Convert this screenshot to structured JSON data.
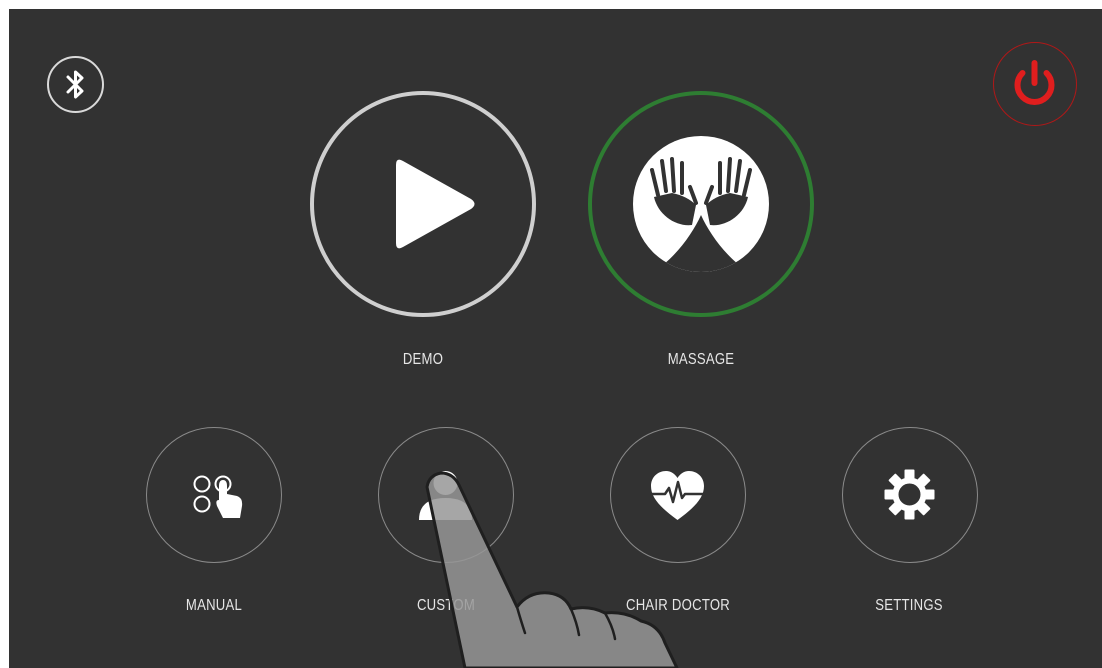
{
  "colors": {
    "background": "#323232",
    "demo_ring": "#cfcfcf",
    "massage_ring": "#2e7d32",
    "power_accent": "#e01e1e",
    "small_ring": "#8a8a8a",
    "label": "#e6e6e6"
  },
  "top_bar": {
    "bluetooth_icon": "bluetooth-icon",
    "power_icon": "power-icon"
  },
  "main_modes": [
    {
      "label": "DEMO",
      "icon": "play-icon"
    },
    {
      "label": "MASSAGE",
      "icon": "hands-icon"
    }
  ],
  "sub_modes": [
    {
      "label": "MANUAL",
      "icon": "manual-touch-icon"
    },
    {
      "label": "CUSTOM",
      "icon": "user-icon"
    },
    {
      "label": "CHAIR DOCTOR",
      "icon": "heart-pulse-icon"
    },
    {
      "label": "SETTINGS",
      "icon": "gear-icon"
    }
  ],
  "overlay": {
    "icon": "pointing-hand-icon"
  }
}
